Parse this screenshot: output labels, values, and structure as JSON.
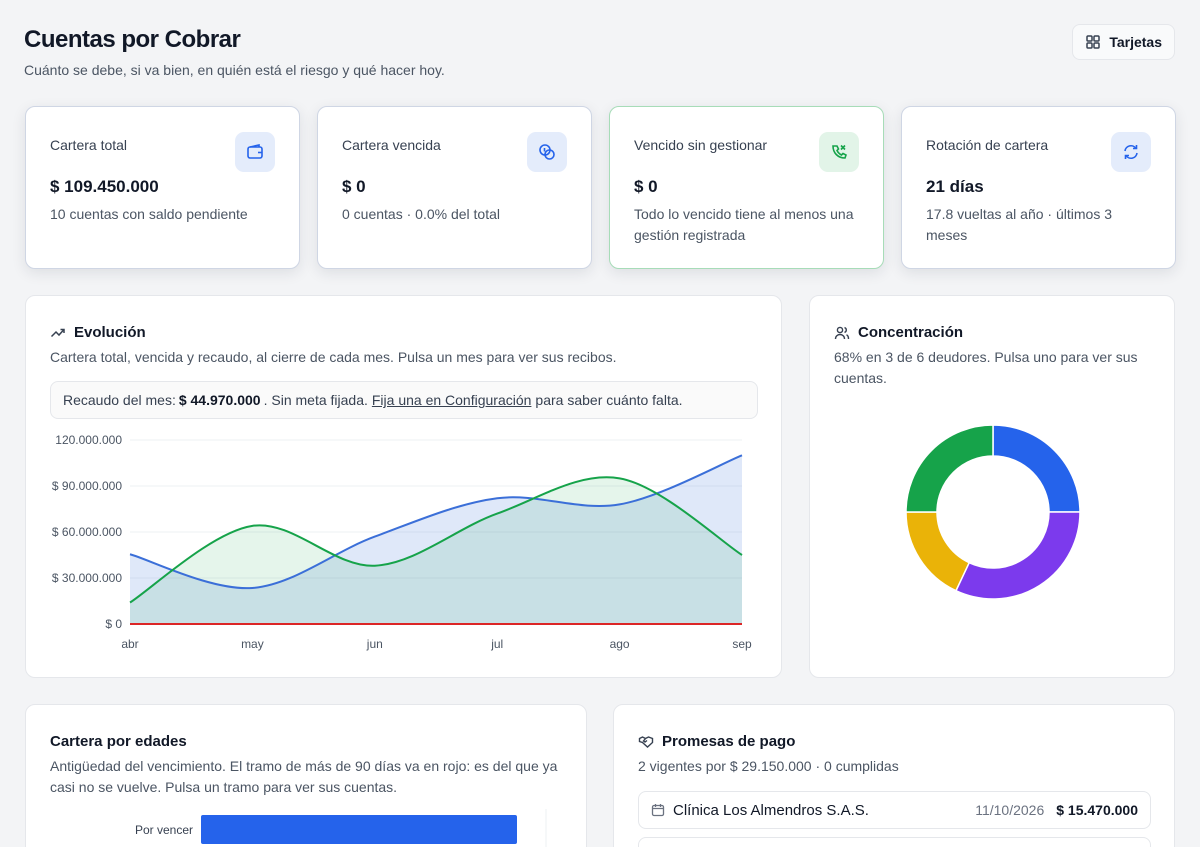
{
  "header": {
    "title": "Cuentas por Cobrar",
    "subtitle": "Cuánto se debe, si va bien, en quién está el riesgo y qué hacer hoy.",
    "view_button_label": "Tarjetas",
    "view_button_icon": "grid-icon"
  },
  "kpis": [
    {
      "label": "Cartera total",
      "value": "$ 109.450.000",
      "desc": "10 cuentas con saldo pendiente",
      "icon": "wallet-icon",
      "accent": "#2563eb"
    },
    {
      "label": "Cartera vencida",
      "value": "$ 0",
      "desc": "0 cuentas · 0.0% del total",
      "icon": "coins-icon",
      "accent": "#2563eb"
    },
    {
      "label": "Vencido sin gestionar",
      "value": "$ 0",
      "desc": "Todo lo vencido tiene al menos una gestión registrada",
      "icon": "phone-off-icon",
      "accent": "#16a34a"
    },
    {
      "label": "Rotación de cartera",
      "value": "21 días",
      "desc": "17.8 vueltas al año · últimos 3 meses",
      "icon": "refresh-icon",
      "accent": "#2563eb"
    }
  ],
  "evolution": {
    "title": "Evolución",
    "desc": "Cartera total, vencida y recaudo, al cierre de cada mes. Pulsa un mes para ver sus recibos.",
    "note_prefix": "Recaudo del mes:",
    "note_amount": "$ 44.970.000",
    "note_mid": ". Sin meta fijada.",
    "note_link": "Fija una en Configuración",
    "note_suffix": "para saber cuánto falta."
  },
  "chart_data": {
    "type": "area",
    "categories": [
      "abr",
      "may",
      "jun",
      "jul",
      "ago",
      "sep"
    ],
    "series": [
      {
        "values": [
          45500000,
          23500000,
          57000000,
          82000000,
          78000000,
          110000000
        ],
        "color": "#3b6fd8"
      },
      {
        "values": [
          0,
          0,
          0,
          0,
          0,
          0
        ],
        "color": "#dc2626"
      },
      {
        "values": [
          14000000,
          64000000,
          38000000,
          72000000,
          95000000,
          45000000
        ],
        "color": "#16a34a"
      }
    ],
    "y_ticks": [
      "120.000.000",
      "$ 90.000.000",
      "$ 60.000.000",
      "$ 30.000.000",
      "$ 0"
    ],
    "ylim": [
      0,
      120000000
    ],
    "grid": true
  },
  "concentration": {
    "title": "Concentración",
    "desc": "68% en 3 de 6 deudores. Pulsa uno para ver sus cuentas.",
    "icon": "users-icon",
    "donut": {
      "type": "pie",
      "values": [
        25,
        32,
        18,
        25
      ],
      "colors": [
        "#2563eb",
        "#7c3aed",
        "#eab308",
        "#16a34a"
      ]
    }
  },
  "aging": {
    "title": "Cartera por edades",
    "desc": "Antigüedad del vencimiento. El tramo de más de 90 días va en rojo: es del que ya casi no se vuelve. Pulsa un tramo para ver sus cuentas.",
    "bars": [
      {
        "label": "Por vencer",
        "value": 109450000,
        "color": "#2563eb"
      }
    ]
  },
  "promises": {
    "title": "Promesas de pago",
    "summary": "2 vigentes por $ 29.150.000 · 0 cumplidas",
    "icon": "handshake-icon",
    "rows": [
      {
        "client": "Clínica Los Almendros S.A.S.",
        "date": "11/10/2026",
        "amount": "$ 15.470.000",
        "icon": "calendar-icon"
      }
    ]
  }
}
